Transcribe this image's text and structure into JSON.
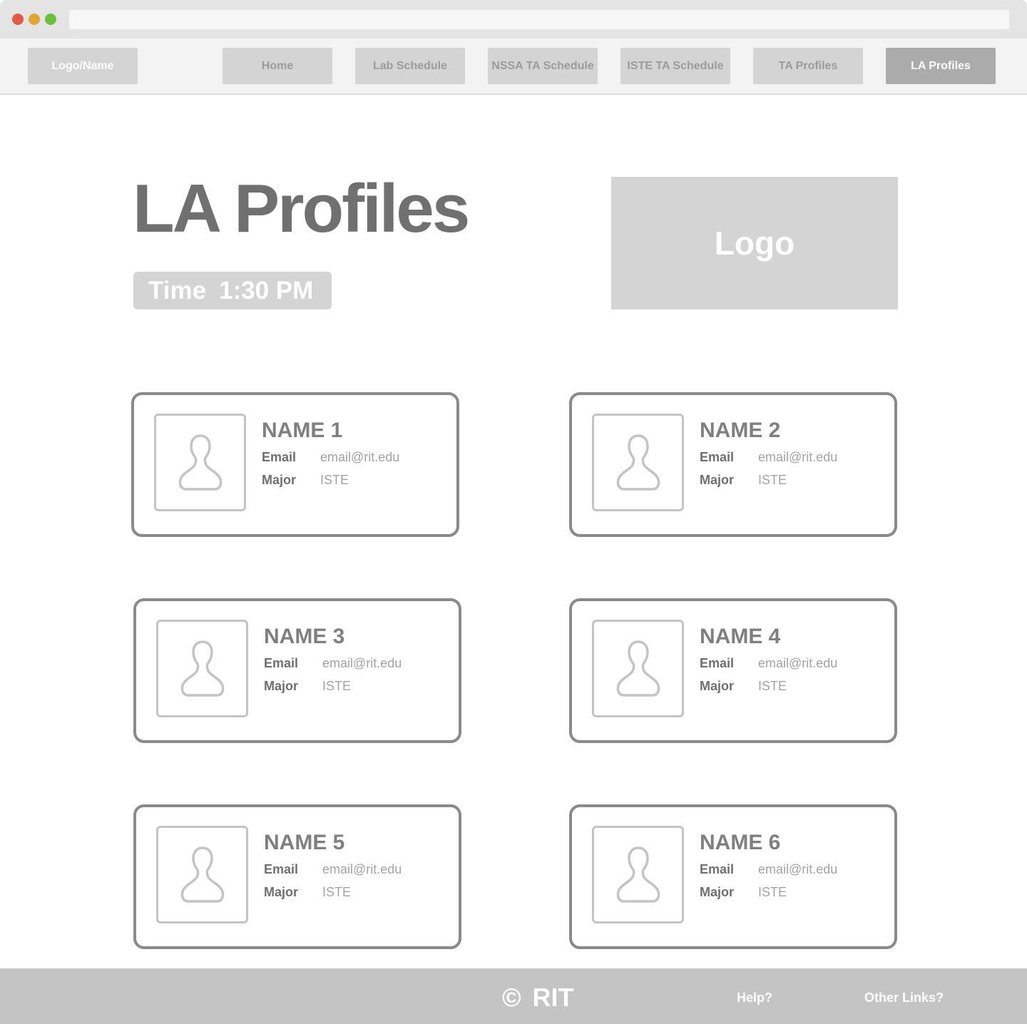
{
  "nav": {
    "logo_label": "Logo/Name",
    "items": [
      {
        "label": "Home"
      },
      {
        "label": "Lab Schedule"
      },
      {
        "label": "NSSA TA Schedule"
      },
      {
        "label": "ISTE TA Schedule"
      },
      {
        "label": "TA Profiles"
      },
      {
        "label": "LA Profiles",
        "active": true
      }
    ]
  },
  "header": {
    "title": "LA Profiles",
    "time_label": "Time",
    "time_value": "1:30 PM",
    "logo_text": "Logo"
  },
  "labels": {
    "email": "Email",
    "major": "Major"
  },
  "profiles": [
    {
      "name": "NAME 1",
      "email": "email@rit.edu",
      "major": "ISTE"
    },
    {
      "name": "NAME 2",
      "email": "email@rit.edu",
      "major": "ISTE"
    },
    {
      "name": "NAME 3",
      "email": "email@rit.edu",
      "major": "ISTE"
    },
    {
      "name": "NAME 4",
      "email": "email@rit.edu",
      "major": "ISTE"
    },
    {
      "name": "NAME 5",
      "email": "email@rit.edu",
      "major": "ISTE"
    },
    {
      "name": "NAME 6",
      "email": "email@rit.edu",
      "major": "ISTE"
    }
  ],
  "footer": {
    "copyright_symbol": "©",
    "copyright_text": "RIT",
    "help_link": "Help?",
    "other_links": "Other Links?"
  },
  "colors": {
    "chrome_close": "#e15a45",
    "chrome_minimize": "#e0a632",
    "chrome_maximize": "#6fbf3f",
    "nav_button": "#d4d4d4",
    "nav_active": "#ababab",
    "card_border": "#8a8a8a",
    "footer_bg": "#c4c4c4"
  },
  "icons": {
    "avatar": "person-silhouette-icon"
  }
}
